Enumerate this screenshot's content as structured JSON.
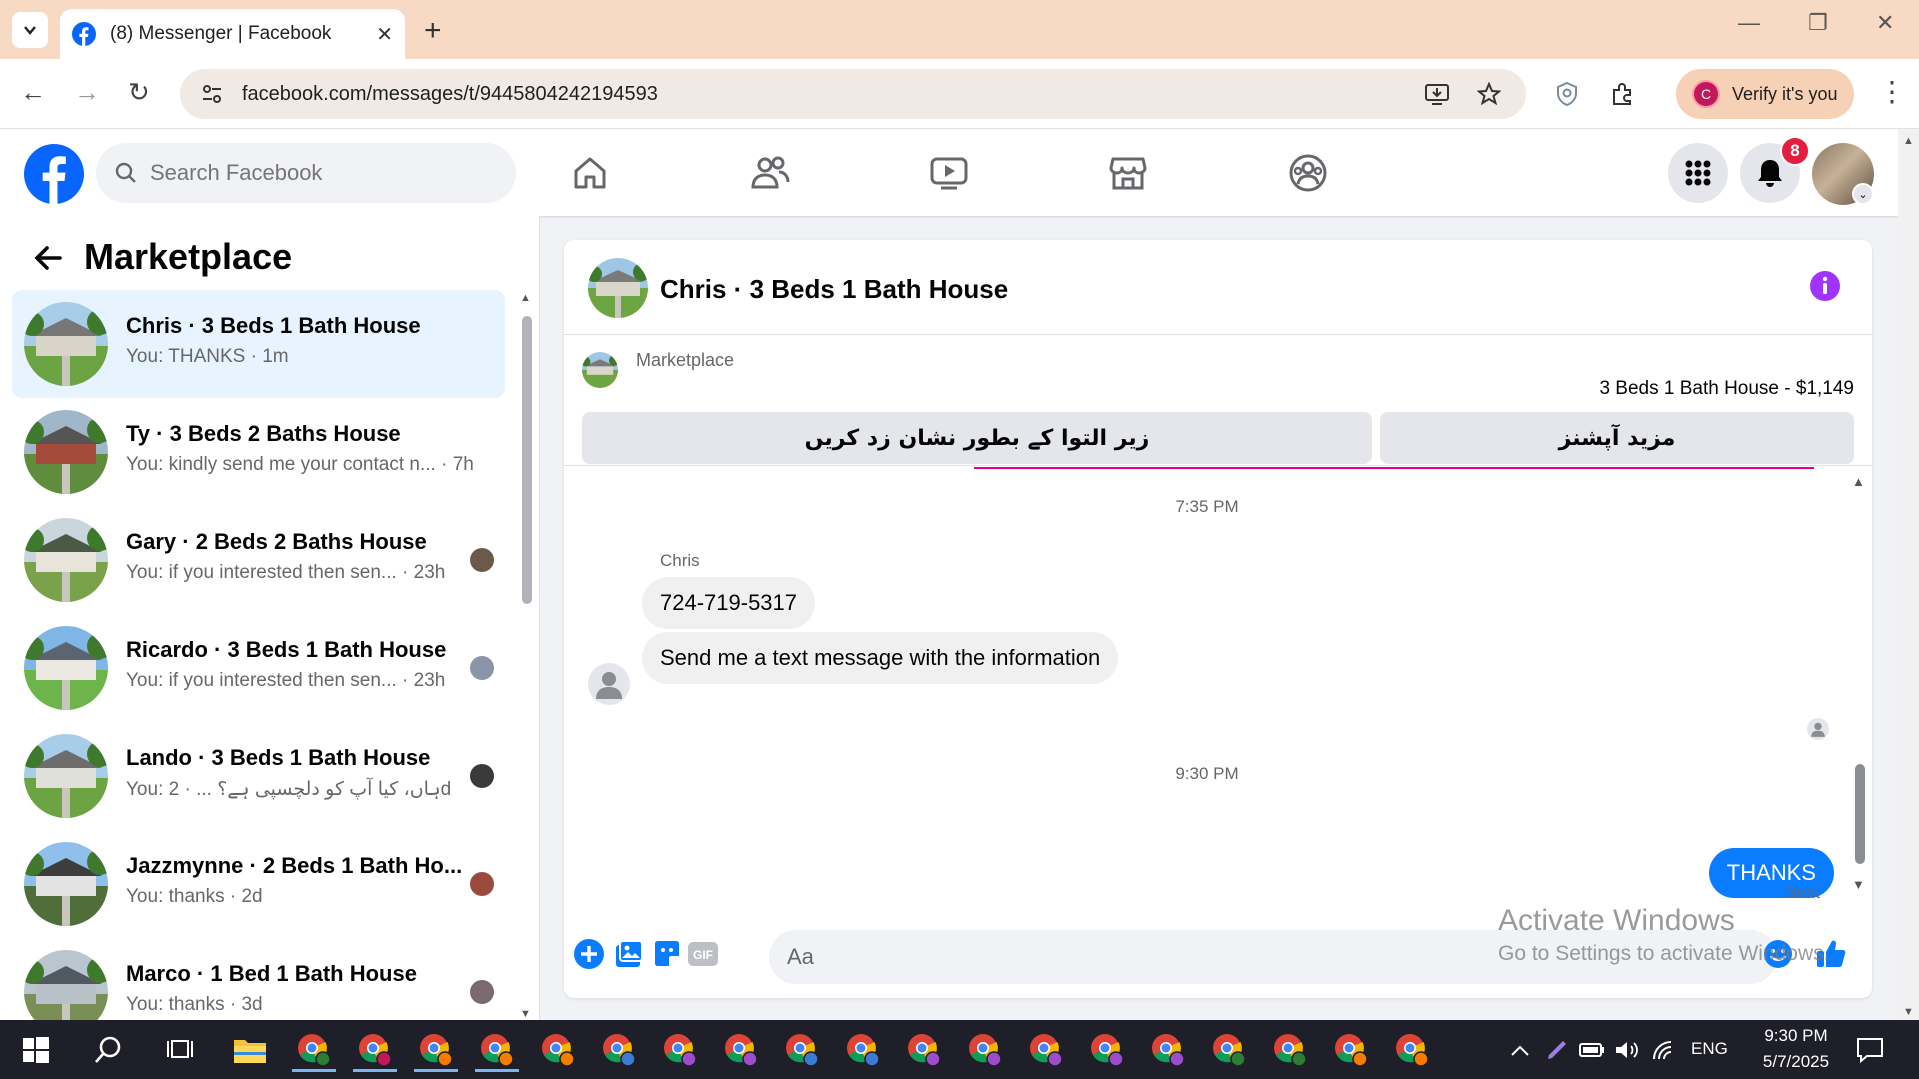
{
  "browser": {
    "tab_title": "(8) Messenger | Facebook",
    "url": "facebook.com/messages/t/9445804242194593",
    "verify_label": "Verify it's you",
    "verify_initial": "C"
  },
  "facebook": {
    "search_placeholder": "Search Facebook",
    "notification_count": "8",
    "nav_tabs": [
      "home-icon",
      "friends-icon",
      "video-icon",
      "marketplace-icon",
      "groups-icon"
    ]
  },
  "sidebar": {
    "title": "Marketplace",
    "conversations": [
      {
        "title": "Chris · 3 Beds 1 Bath House",
        "subtitle": "You: THANKS · 1m",
        "active": true
      },
      {
        "title": "Ty · 3 Beds 2 Baths House",
        "subtitle": "You: kindly send me your contact n... · 7h",
        "active": false
      },
      {
        "title": "Gary · 2 Beds 2 Baths House",
        "subtitle": "You: if you interested then sen... · 23h",
        "active": false
      },
      {
        "title": "Ricardo · 3 Beds 1 Bath House",
        "subtitle": "You: if you interested then sen... · 23h",
        "active": false
      },
      {
        "title": "Lando · 3 Beds 1 Bath House",
        "subtitle": "You: ہاں، کیا آپ کو دلچسپی ہے؟ ... · 2d",
        "active": false
      },
      {
        "title": "Jazzmynne · 2 Beds 1 Bath Ho...",
        "subtitle": "You: thanks · 2d",
        "active": false
      },
      {
        "title": "Marco · 1 Bed 1 Bath House",
        "subtitle": "You: thanks · 3d",
        "active": false
      }
    ]
  },
  "chat": {
    "title": "Chris · 3 Beds 1 Bath House",
    "listing": {
      "label": "Marketplace",
      "price_line": "3 Beds 1 Bath House - $1,149",
      "button_left": "زیر التوا کے بطور نشان زد کریں",
      "button_right": "مزید آپشنز"
    },
    "time_1": "7:35 PM",
    "sender": "Chris",
    "incoming": [
      "724-719-5317",
      "Send me a text message with the information"
    ],
    "time_2": "9:30 PM",
    "outgoing": "THANKS",
    "status": "Sent",
    "composer_placeholder": "Aa"
  },
  "watermark": {
    "title": "Activate Windows",
    "subtitle": "Go to Settings to activate Windows."
  },
  "taskbar": {
    "language": "ENG",
    "time": "9:30 PM",
    "date": "5/7/2025"
  }
}
